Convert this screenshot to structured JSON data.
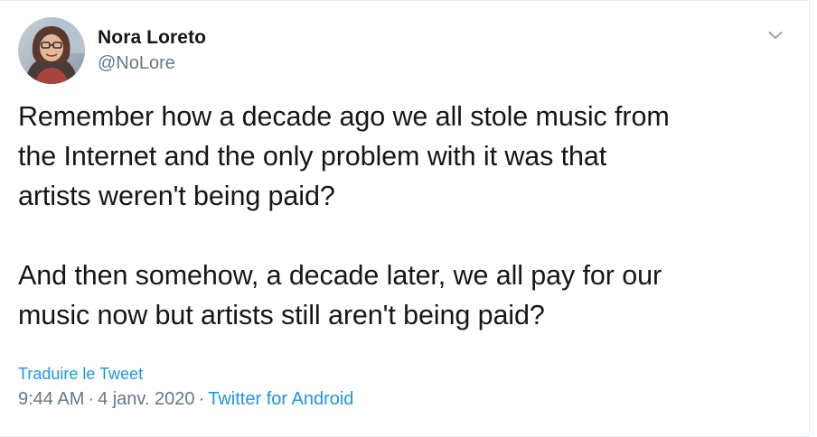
{
  "author": {
    "display_name": "Nora Loreto",
    "handle": "@NoLore",
    "avatar_icon": "profile-photo-avatar"
  },
  "menu": {
    "caret_icon": "chevron-down-icon"
  },
  "tweet": {
    "paragraphs": [
      "Remember how a decade ago we all stole music from\nthe Internet and the only problem with it was that\nartists weren't being paid?",
      "And then somehow, a decade later, we all pay for our\nmusic now but artists still aren't being paid?"
    ]
  },
  "translate_label": "Traduire le Tweet",
  "meta": {
    "time": "9:44 AM",
    "separator": "·",
    "date": "4 janv. 2020",
    "source": "Twitter for Android"
  },
  "colors": {
    "text": "#14171a",
    "secondary": "#657786",
    "link": "#1b95e0",
    "border": "#e6ecf0"
  }
}
